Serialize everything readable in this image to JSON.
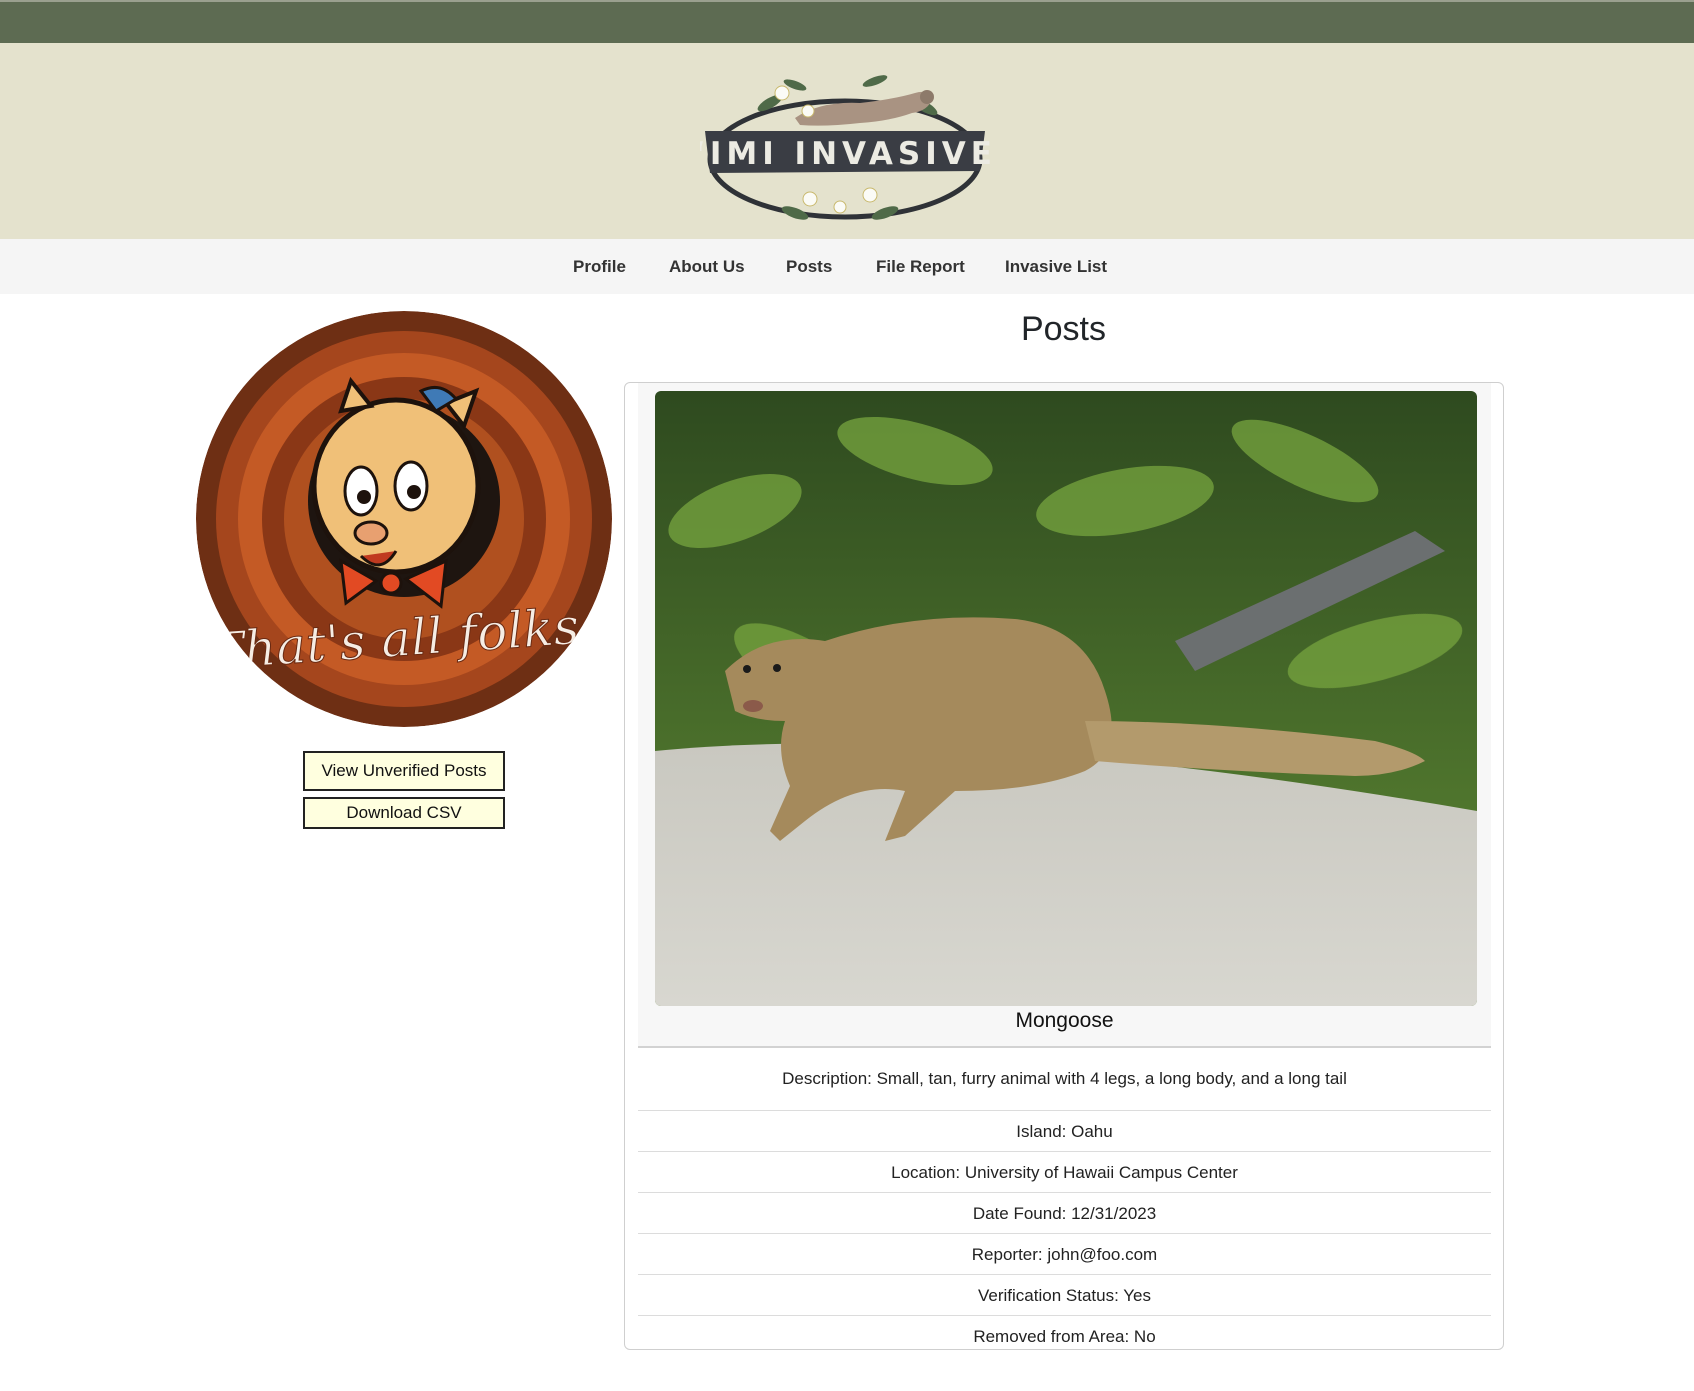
{
  "header": {
    "logo_text": "‘IMI INVASIVE",
    "logo_icon": "mongoose-logo-icon"
  },
  "nav": {
    "items": [
      {
        "label": "Profile"
      },
      {
        "label": "About Us"
      },
      {
        "label": "Posts"
      },
      {
        "label": "File Report"
      },
      {
        "label": "Invasive List"
      }
    ]
  },
  "sidebar": {
    "avatar_caption": "That's all folks",
    "view_unverified_label": "View Unverified Posts",
    "download_csv_label": "Download CSV"
  },
  "main": {
    "title": "Posts",
    "post": {
      "species": "Mongoose",
      "description": "Description: Small, tan, furry animal with 4 legs, a long body, and a long tail",
      "island": "Island: Oahu",
      "location": "Location: University of Hawaii Campus Center",
      "date_found": "Date Found: 12/31/2023",
      "reporter": "Reporter: john@foo.com",
      "verification": "Verification Status: Yes",
      "removed": "Removed from Area: No"
    }
  },
  "colors": {
    "topbar": "#5d6b52",
    "banner": "#e4e2cd",
    "navbar": "#f5f5f5",
    "button_bg": "#ffffdf"
  }
}
